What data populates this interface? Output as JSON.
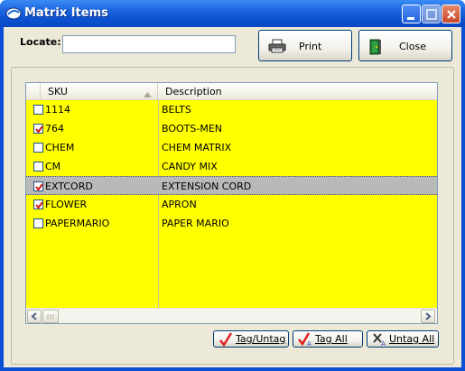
{
  "window": {
    "title": "Matrix Items"
  },
  "toolbar": {
    "locate_label": "Locate:",
    "locate_value": "",
    "print_label": "Print",
    "close_label": "Close"
  },
  "grid": {
    "columns": [
      "SKU",
      "Description"
    ],
    "sort_column": "SKU",
    "sort_direction": "ascending",
    "row_color": "#ffff00",
    "selected_row_color": "#b9b9b9",
    "rows": [
      {
        "sku": "1114",
        "description": "BELTS",
        "checked": false,
        "selected": false
      },
      {
        "sku": "764",
        "description": "BOOTS-MEN",
        "checked": true,
        "selected": false
      },
      {
        "sku": "CHEM",
        "description": "CHEM MATRIX",
        "checked": false,
        "selected": false
      },
      {
        "sku": "CM",
        "description": "CANDY MIX",
        "checked": false,
        "selected": false
      },
      {
        "sku": "EXTCORD",
        "description": "EXTENSION CORD",
        "checked": true,
        "selected": true
      },
      {
        "sku": "FLOWER",
        "description": "APRON",
        "checked": true,
        "selected": false
      },
      {
        "sku": "PAPERMARIO",
        "description": "PAPER MARIO",
        "checked": false,
        "selected": false
      }
    ]
  },
  "actions": {
    "tag_untag_label": "Tag/Untag",
    "tag_all_label": "Tag All",
    "untag_all_label": "Untag All"
  },
  "icons": {
    "app": "window-app-icon",
    "print": "printer-icon",
    "close": "exit-door-icon",
    "tag_untag": "red-checkmark-icon",
    "tag_all": "checkmark-a-icon",
    "untag_all": "x-mark-a-icon"
  }
}
